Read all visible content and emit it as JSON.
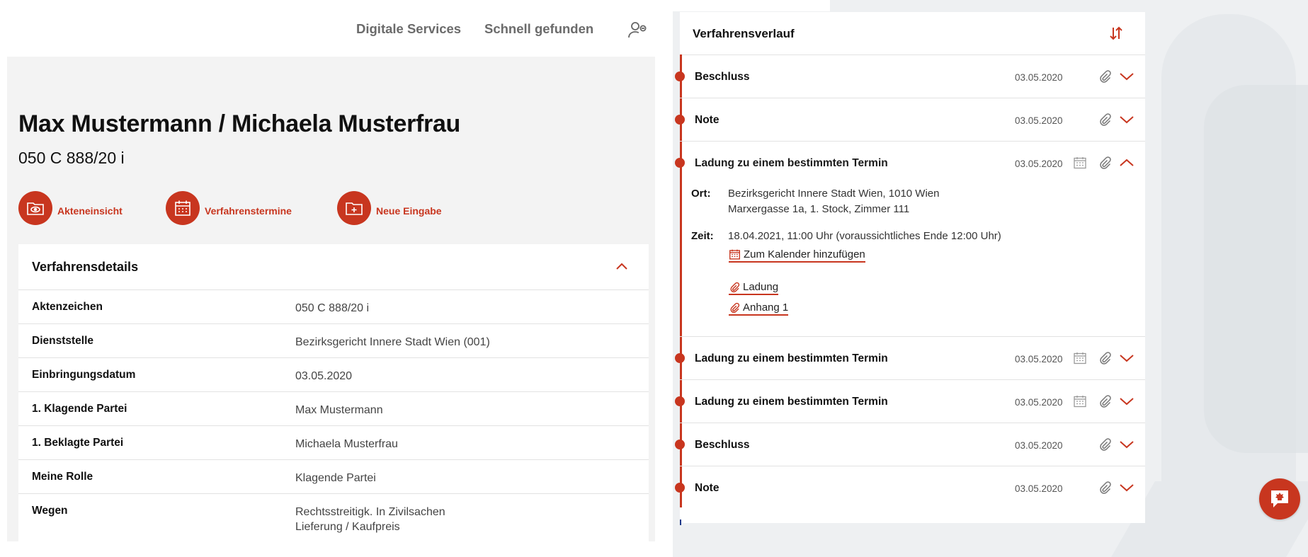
{
  "header": {
    "nav": [
      {
        "label": "Digitale Services"
      },
      {
        "label": "Schnell gefunden"
      }
    ],
    "user_icon": "user-settings-icon"
  },
  "case": {
    "title": "Max Mustermann / Michaela Musterfrau",
    "number": "050 C 888/20 i"
  },
  "actions": [
    {
      "label": "Akteneinsicht",
      "icon": "folder-eye-icon"
    },
    {
      "label": "Verfahrenstermine",
      "icon": "calendar-icon"
    },
    {
      "label": "Neue Eingabe",
      "icon": "folder-plus-icon"
    }
  ],
  "details": {
    "title": "Verfahrensdetails",
    "rows": [
      {
        "label": "Aktenzeichen",
        "value": "050 C 888/20 i"
      },
      {
        "label": "Dienststelle",
        "value": "Bezirksgericht Innere Stadt Wien (001)"
      },
      {
        "label": "Einbringungsdatum",
        "value": "03.05.2020"
      },
      {
        "label": "1. Klagende Partei",
        "value": "Max Mustermann"
      },
      {
        "label": "1. Beklagte Partei",
        "value": "Michaela Musterfrau"
      },
      {
        "label": "Meine Rolle",
        "value": "Klagende Partei"
      },
      {
        "label": "Wegen",
        "value": "Rechtsstreitigk. In Zivilsachen",
        "value2": "Lieferung / Kaufpreis"
      }
    ]
  },
  "timeline": {
    "title": "Verfahrensverlauf",
    "items": [
      {
        "label": "Beschluss",
        "date": "03.05.2020",
        "has_calendar": false,
        "expanded": false
      },
      {
        "label": "Note",
        "date": "03.05.2020",
        "has_calendar": false,
        "expanded": false
      },
      {
        "label": "Ladung zu einem bestimmten Termin",
        "date": "03.05.2020",
        "has_calendar": true,
        "expanded": true
      },
      {
        "label": "Ladung zu einem bestimmten Termin",
        "date": "03.05.2020",
        "has_calendar": true,
        "expanded": false
      },
      {
        "label": "Ladung zu einem bestimmten Termin",
        "date": "03.05.2020",
        "has_calendar": true,
        "expanded": false
      },
      {
        "label": "Beschluss",
        "date": "03.05.2020",
        "has_calendar": false,
        "expanded": false
      },
      {
        "label": "Note",
        "date": "03.05.2020",
        "has_calendar": false,
        "expanded": false
      }
    ],
    "expanded_detail": {
      "ort_label": "Ort:",
      "ort_line1": "Bezirksgericht Innere Stadt Wien, 1010 Wien",
      "ort_line2": "Marxergasse 1a, 1. Stock, Zimmer 111",
      "zeit_label": "Zeit:",
      "zeit_value": "18.04.2021, 11:00 Uhr (voraussichtliches Ende 12:00 Uhr)",
      "calendar_link": "Zum Kalender hinzufügen",
      "attachments": [
        "Ladung",
        "Anhang 1"
      ]
    }
  },
  "colors": {
    "accent": "#c8361f",
    "panel_bg": "#f3f3f3",
    "right_bg": "#eef0f2"
  },
  "chat_icon": "chat-eagle-icon"
}
